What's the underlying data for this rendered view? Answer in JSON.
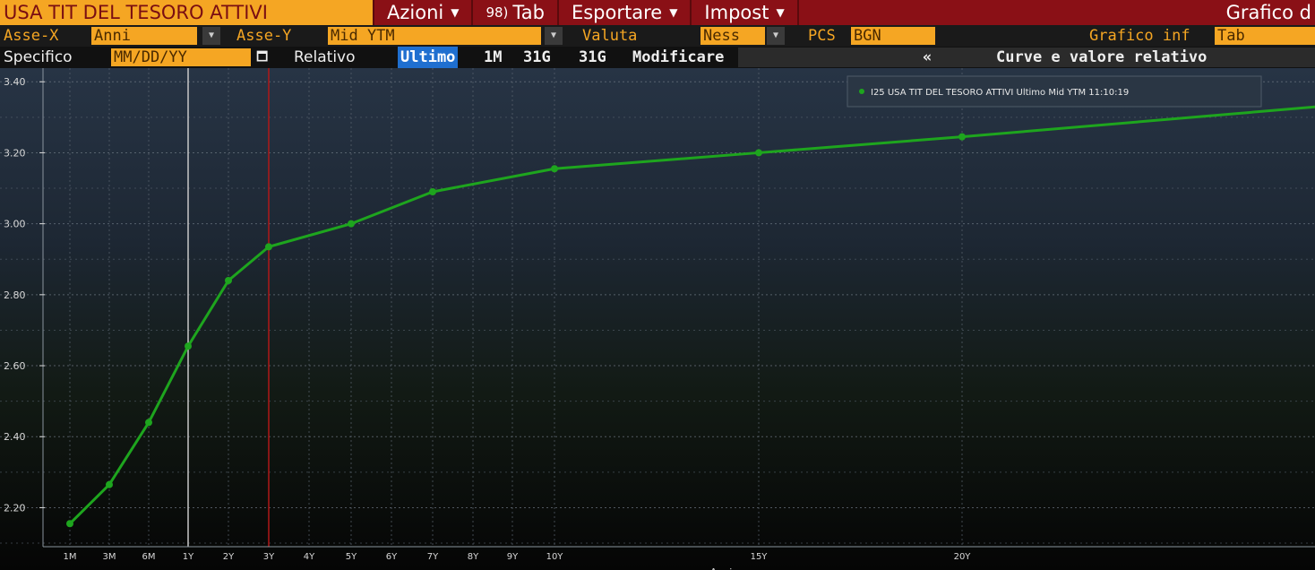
{
  "toolbar": {
    "title": "USA TIT DEL TESORO ATTIVI",
    "menu_actions": "Azioni",
    "menu_tab_num": "98)",
    "menu_tab": "Tab",
    "menu_export": "Esportare",
    "menu_settings": "Impost",
    "right_label": "Grafico d"
  },
  "controls": {
    "x_axis_label": "Asse-X",
    "x_axis_value": "Anni",
    "y_axis_label": "Asse-Y",
    "y_axis_value": "Mid YTM",
    "currency_label": "Valuta",
    "currency_value": "Ness",
    "pcs_label": "PCS",
    "pcs_value": "BGN",
    "chart_info_label": "Grafico inf",
    "chart_info_value": "Tab"
  },
  "range_bar": {
    "specific_label": "Specifico",
    "date_placeholder": "MM/DD/YY",
    "relative_label": "Relativo",
    "btn_last": "Ultimo",
    "btn_1m": "1M",
    "btn_31g_a": "31G",
    "btn_31g_b": "31G",
    "btn_edit": "Modificare",
    "collapse": "«",
    "panel_title": "Curve e valore relativo"
  },
  "colors": {
    "accent_orange": "#f5a623",
    "toolbar_red": "#8a1016",
    "series_green": "#1ea51e",
    "selected_blue": "#1f6fd0",
    "marker_red": "#b01818"
  },
  "chart_data": {
    "type": "line",
    "x_labels": [
      "1M",
      "3M",
      "6M",
      "1Y",
      "2Y",
      "3Y",
      "4Y",
      "5Y",
      "6Y",
      "7Y",
      "8Y",
      "9Y",
      "10Y",
      "15Y",
      "20Y"
    ],
    "xlabel": "Anni",
    "ylabel": "",
    "y_ticks": [
      "3.40",
      "3.20",
      "3.00",
      "2.80",
      "2.60",
      "2.40",
      "2.20"
    ],
    "ylim": [
      2.09,
      3.44
    ],
    "grid": true,
    "legend_position": "top-right",
    "series": [
      {
        "name": "I25 USA TIT DEL TESORO ATTIVI Ultimo Mid YTM 11:10:19",
        "color": "#1ea51e",
        "points": [
          {
            "x": "1M",
            "y": 2.155
          },
          {
            "x": "3M",
            "y": 2.265
          },
          {
            "x": "6M",
            "y": 2.44
          },
          {
            "x": "1Y",
            "y": 2.655
          },
          {
            "x": "2Y",
            "y": 2.84
          },
          {
            "x": "3Y",
            "y": 2.935
          },
          {
            "x": "5Y",
            "y": 3.0
          },
          {
            "x": "7Y",
            "y": 3.09
          },
          {
            "x": "10Y",
            "y": 3.155
          },
          {
            "x": "15Y",
            "y": 3.2
          },
          {
            "x": "20Y",
            "y": 3.245
          },
          {
            "x": "30Y",
            "y": 3.33
          }
        ]
      }
    ],
    "vertical_markers": [
      {
        "x": "1Y",
        "color": "#c8c8c8"
      },
      {
        "x": "3Y",
        "color": "#b01818"
      }
    ]
  }
}
